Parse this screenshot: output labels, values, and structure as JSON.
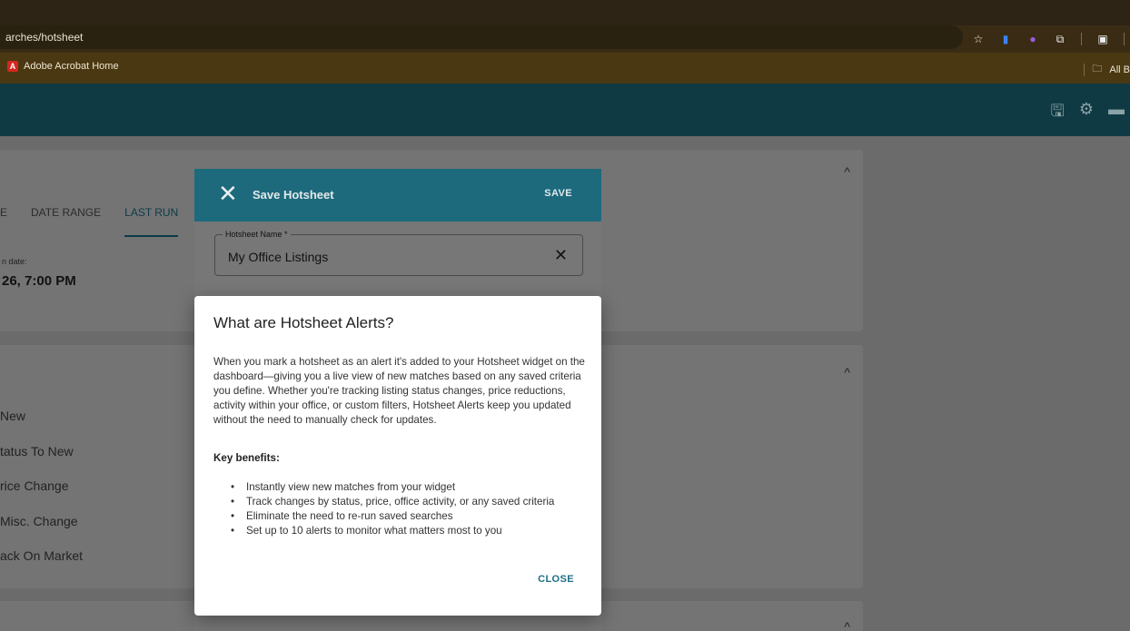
{
  "browser": {
    "url": "arches/hotsheet",
    "bookmark_pdf_label": "Adobe Acrobat Home",
    "all_bookmarks_label": "All B"
  },
  "background": {
    "tabs": [
      "E",
      "DATE RANGE",
      "LAST RUN"
    ],
    "run_date_label": "n date:",
    "run_date_value": "26, 7:00 PM",
    "status_items": [
      "New",
      "tatus To New",
      "rice Change",
      "Misc. Change",
      "ack On Market"
    ]
  },
  "save_dialog": {
    "title": "Save Hotsheet",
    "save_label": "SAVE",
    "field_label": "Hotsheet Name *",
    "field_value": "My Office Listings"
  },
  "info_dialog": {
    "title": "What are Hotsheet Alerts?",
    "body": "When you mark a hotsheet as an alert it's added to your Hotsheet widget on the dashboard—giving you a live view of new matches based on any saved criteria you define. Whether you're tracking listing status changes, price reductions, activity within your office, or custom filters, Hotsheet Alerts keep you updated without the need to manually check for updates.",
    "benefits_title": "Key benefits:",
    "benefits": [
      "Instantly view new matches from your widget",
      "Track changes by status, price, office activity, or any saved criteria",
      "Eliminate the need to re-run saved searches",
      "Set up to 10 alerts to monitor what matters most to you"
    ],
    "close_label": "CLOSE"
  },
  "icons": {
    "header": [
      "save-icon",
      "gear-icon",
      "folder-icon"
    ],
    "browser_extensions": [
      "star-icon",
      "extension-blue-icon",
      "extension-purple-icon",
      "puzzle-icon",
      "reader-icon"
    ]
  }
}
